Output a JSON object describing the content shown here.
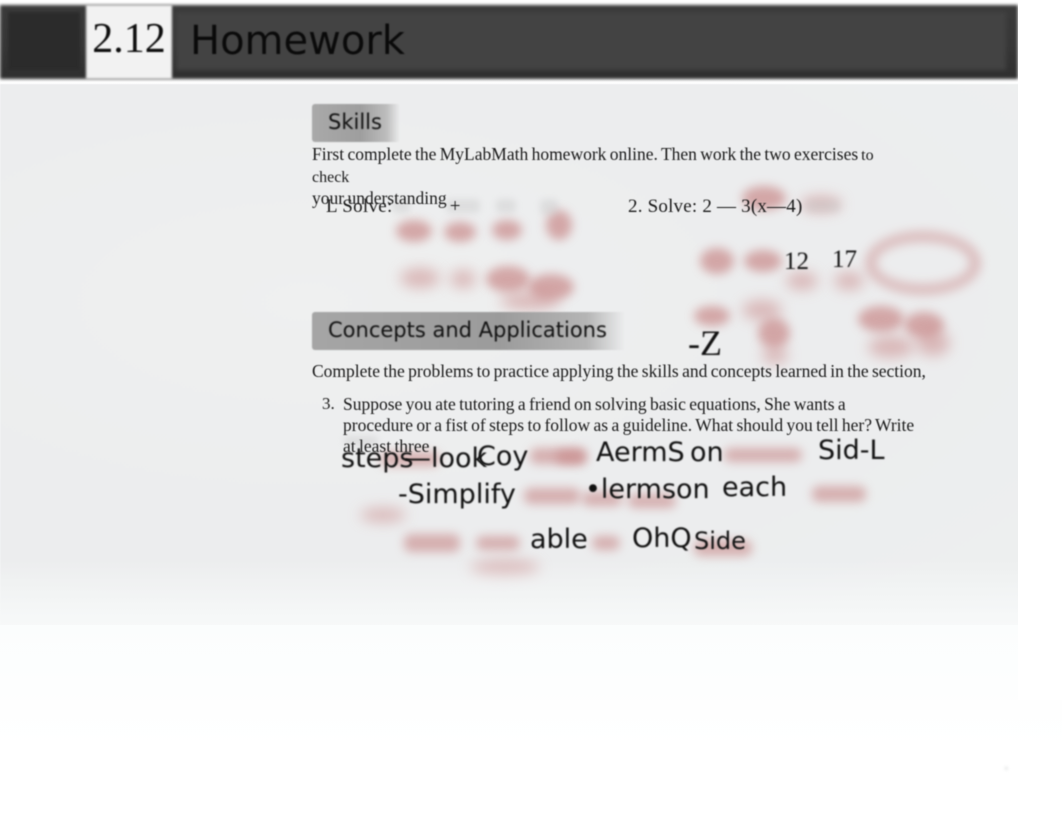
{
  "document": {
    "type": "scanned-worksheet",
    "section_number": "2.12",
    "title": "Homework"
  },
  "header": {
    "chapter_number": "2.12",
    "title": "Homework"
  },
  "sections": {
    "skills": {
      "badge_label": "Skills",
      "instructions_main": "First complete the MyLabMath homework  online. Then work  the two exercises",
      "instructions_tail": " to check",
      "instructions_line2": "your understanding",
      "problems": [
        {
          "number": "L",
          "prompt": "Solve:",
          "expression": "+"
        },
        {
          "number": "2.",
          "prompt": "Solve:",
          "expression": "2 — 3(x—4)"
        }
      ]
    },
    "concepts": {
      "badge_label": "Concepts and Applications",
      "instructions": "Complete the problems  to  practice applying the skills and concepts learned  in the section,",
      "problems": [
        {
          "number": "3.",
          "text": "Suppose you  ate tutoring a friend on solving basic  equations, She wants a procedure or a fist of steps to follow as a guideline. What  should you  tell her? Write at least three"
        }
      ]
    }
  },
  "handwriting": {
    "margin_notes": [
      {
        "id": "ink-12",
        "text": "12"
      },
      {
        "id": "ink-17",
        "text": "17"
      },
      {
        "id": "ink-neg-z",
        "text": "-Z"
      }
    ],
    "answer_lines": [
      {
        "id": "ink-steps",
        "text": "steps"
      },
      {
        "id": "ink-look",
        "text": "—look"
      },
      {
        "id": "ink-coy",
        "text": "Coy"
      },
      {
        "id": "ink-aerms",
        "text": "AermS"
      },
      {
        "id": "ink-on",
        "text": "on"
      },
      {
        "id": "ink-sidl",
        "text": "Sid-L"
      },
      {
        "id": "ink-simplify",
        "text": "-Simplify"
      },
      {
        "id": "ink-lermson",
        "text": "•lermson"
      },
      {
        "id": "ink-each",
        "text": "each"
      },
      {
        "id": "ink-able",
        "text": "able"
      },
      {
        "id": "ink-ohq",
        "text": "OhQ"
      },
      {
        "id": "ink-side",
        "text": "Side"
      }
    ]
  },
  "page": {
    "corner_mark": "·"
  },
  "colors": {
    "header_bar": "#3b3b3b",
    "chapter_badge": "#f2f2f2",
    "section_badge": "#a5a5a5",
    "red_pen": "#c98b8b",
    "paper": "#ecedee",
    "text": "#1a1a1a"
  }
}
